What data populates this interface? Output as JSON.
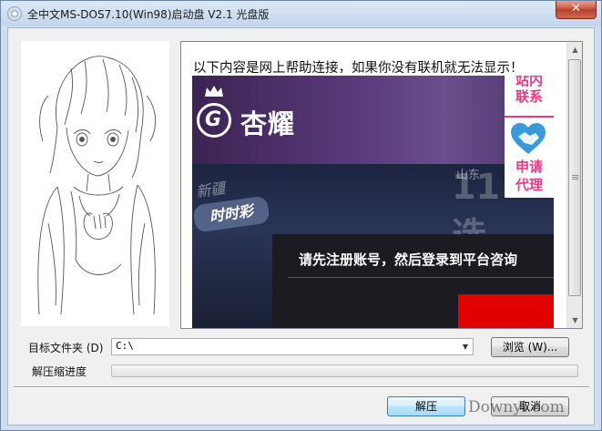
{
  "window": {
    "title": "全中文MS-DOS7.10(Win98)启动盘 V2.1 光盘版",
    "close_label": "✕"
  },
  "content": {
    "help_text": "以下内容是网上帮助连接，如果你没有联机就无法显示！",
    "banner": {
      "logo_text": "杏耀",
      "side_contact": "站内\n联系",
      "side_apply": "申请\n代理",
      "lottery_left_title": "新疆",
      "lottery_left_badge": "时时彩",
      "lottery_right_title": "山东",
      "lottery_right_big": "11选5",
      "prompt": "请先注册账号，然后登录到平台咨询"
    }
  },
  "form": {
    "target_folder_label": "目标文件夹 (D)",
    "target_folder_value": "C:\\",
    "browse_label": "浏览 (W)...",
    "progress_label": "解压缩进度",
    "progress_value": 0
  },
  "buttons": {
    "extract_label": "解压",
    "cancel_label": "取消"
  },
  "watermark": "Downyi.com",
  "colors": {
    "titlebar": "#c4d6ec",
    "close_button": "#c75a44",
    "accent_pink": "#e83b83",
    "primary_button": "#bee6fd"
  }
}
